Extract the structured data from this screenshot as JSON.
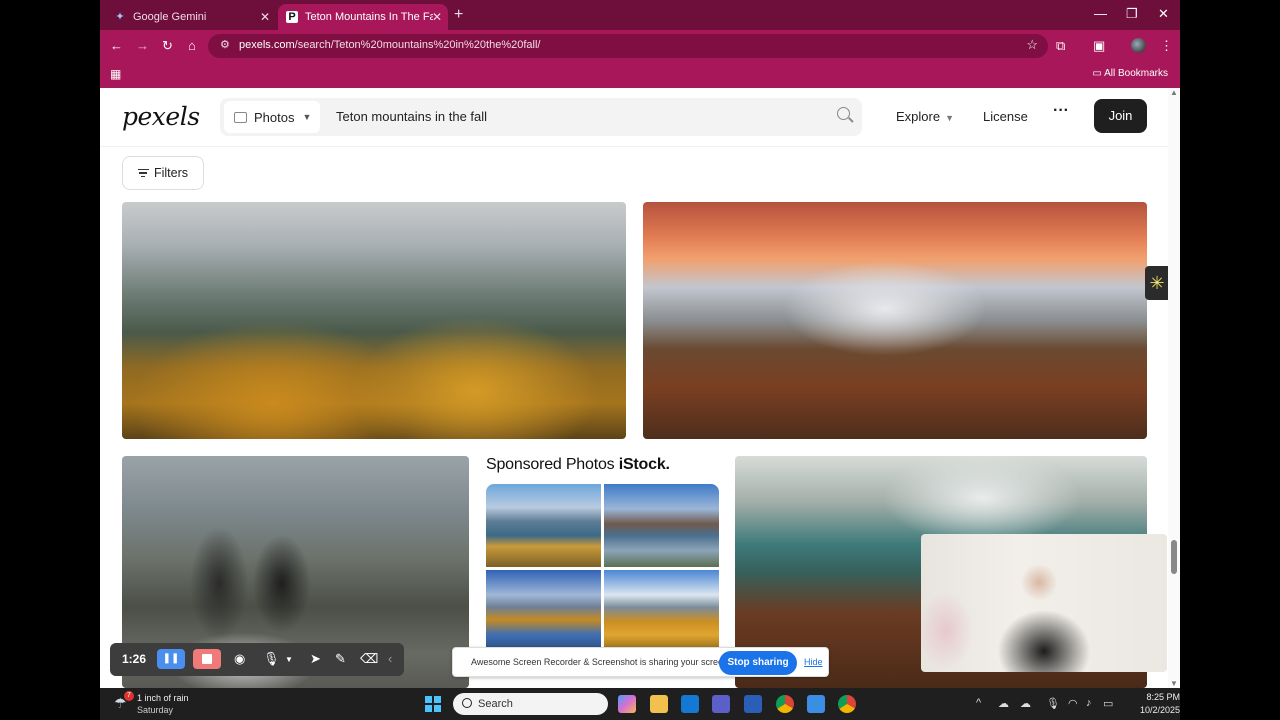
{
  "browser": {
    "tabs": [
      {
        "title": "Google Gemini",
        "icon": "gemini-icon"
      },
      {
        "title": "Teton Mountains In The Fall Ph",
        "icon": "pexels-icon",
        "active": true
      }
    ],
    "url_domain": "pexels.com",
    "url_path": "/search/Teton%20mountains%20in%20the%20fall/",
    "bookmarks_label": "All Bookmarks",
    "accent": "#a8175a"
  },
  "header": {
    "logo": "pexels",
    "media_type": "Photos",
    "query": "Teton mountains in the fall",
    "nav_explore": "Explore",
    "nav_license": "License",
    "nav_more": "···",
    "join_label": "Join"
  },
  "filters_label": "Filters",
  "sponsored": {
    "title": "Sponsored Photos",
    "brand": "iStock."
  },
  "recorder": {
    "time": "1:26"
  },
  "share_bar": {
    "message": "Awesome Screen Recorder & Screenshot is sharing your screen.",
    "stop_label": "Stop sharing",
    "hide_label": "Hide"
  },
  "taskbar": {
    "weather_badge": "7",
    "weather_line1": "1 inch of rain",
    "weather_line2": "Saturday",
    "search_placeholder": "Search",
    "time": "8:25 PM",
    "date": "10/2/2025"
  }
}
